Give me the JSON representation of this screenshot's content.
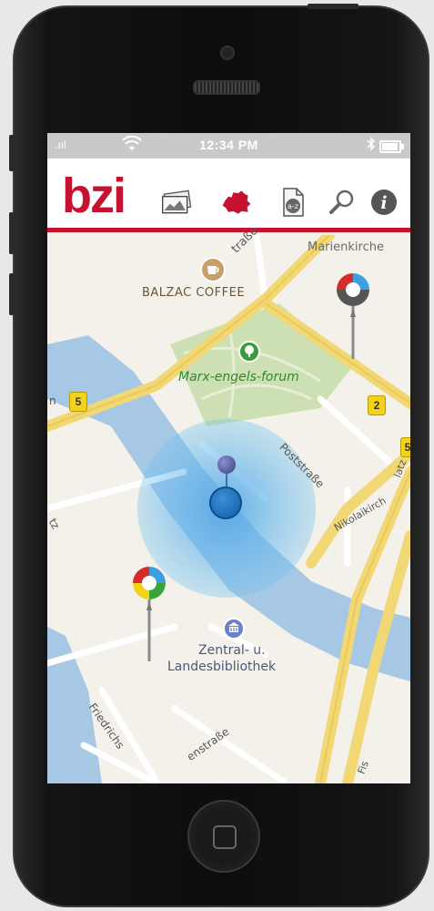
{
  "status_bar": {
    "signal": ".ııl",
    "wifi": "wifi-icon",
    "time": "12:34 PM",
    "bluetooth": "bluetooth-icon",
    "battery_level": 0.85
  },
  "app": {
    "logo": "bzi",
    "brand_color": "#c41230",
    "nav_icons": [
      "photos-icon",
      "berlin-map-icon",
      "a-z-index-icon",
      "search-icon",
      "info-icon"
    ]
  },
  "map": {
    "streets": {
      "top_street": "traße",
      "poststrasse": "Poststraße",
      "nikolai": "Nikolaikirch",
      "friedrich": "Friedrichs",
      "bottom_street": "enstraße",
      "left_fragment": "tz",
      "right_fragment": "latz",
      "bottom_right": "Fis"
    },
    "pois": {
      "marienkirche": "Marienkirche",
      "balzac": "BALZAC COFFEE",
      "marx_engels": "Marx-engels-forum",
      "library_line1": "Zentral- u.",
      "library_line2": "Landesbibliothek"
    },
    "route_shields": {
      "left_label": "n",
      "left": "5",
      "right": "2",
      "far_right": "5"
    }
  }
}
